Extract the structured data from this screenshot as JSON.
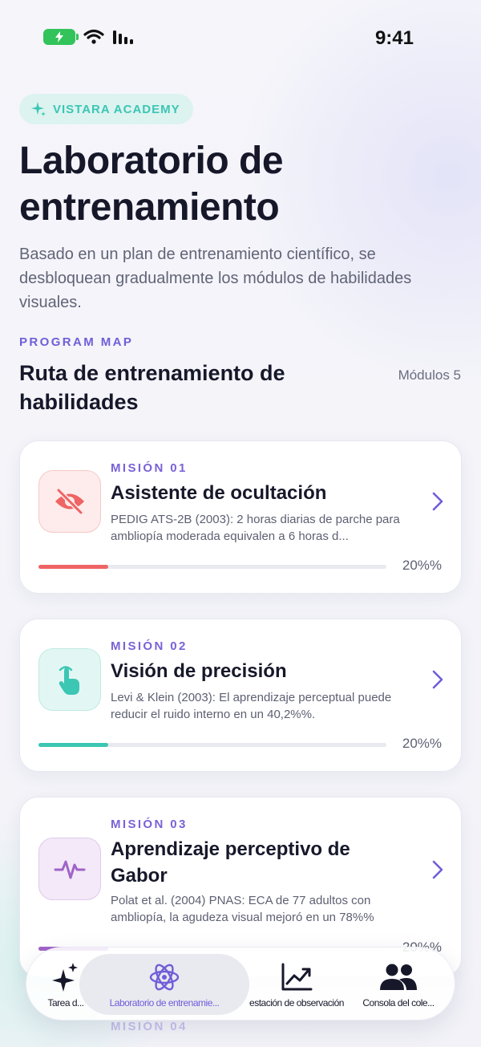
{
  "status_bar": {
    "time": "9:41"
  },
  "header": {
    "badge": "VISTARA ACADEMY",
    "title": "Laboratorio de entrenamiento",
    "subtitle": "Basado en un plan de entrenamiento científico, se desbloquean gradualmente los módulos de habilidades visuales."
  },
  "program": {
    "label": "PROGRAM MAP",
    "title": "Ruta de entrenamiento de habilidades",
    "count": "Módulos 5"
  },
  "missions": [
    {
      "mission": "MISIÓN 01",
      "title": "Asistente de ocultación",
      "description": "PEDIG ATS-2B (2003): 2 horas diarias de parche para ambliopía moderada equivalen a 6 horas d...",
      "progress": 20,
      "progress_label": "20%%",
      "icon": "eye-off-icon",
      "color": "#ef6464"
    },
    {
      "mission": "MISIÓN 02",
      "title": "Visión de precisión",
      "description": "Levi & Klein (2003): El aprendizaje perceptual puede reducir el ruido interno en un 40,2%%.",
      "progress": 20,
      "progress_label": "20%%",
      "icon": "tap-hand-icon",
      "color": "#3cc6b4"
    },
    {
      "mission": "MISIÓN 03",
      "title": "Aprendizaje perceptivo de Gabor",
      "description": "Polat et al. (2004) PNAS: ECA de 77 adultos con ambliopía, la agudeza visual mejoró en un 78%%",
      "progress": 20,
      "progress_label": "20%%",
      "icon": "pulse-wave-icon",
      "color": "#a064c8"
    }
  ],
  "next_mission_peek": "MISIÓN 04",
  "tabs": [
    {
      "label": "Tarea d...",
      "icon": "sparkles-icon",
      "active": false
    },
    {
      "label": "Laboratorio de entrenamie...",
      "icon": "atom-icon",
      "active": true
    },
    {
      "label": "estación de observación",
      "icon": "trend-chart-icon",
      "active": false
    },
    {
      "label": "Consola del cole...",
      "icon": "people-icon",
      "active": false
    }
  ]
}
